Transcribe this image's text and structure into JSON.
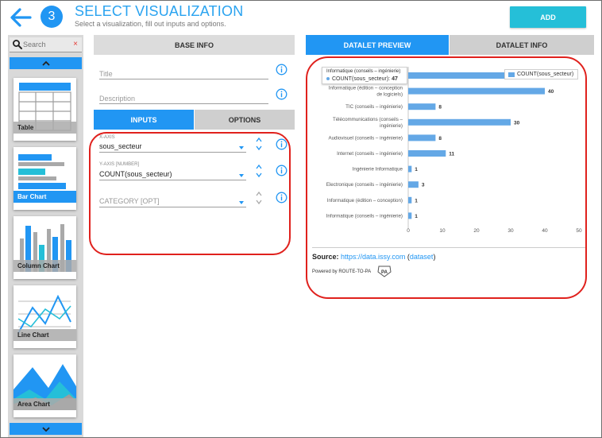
{
  "header": {
    "step_number": "3",
    "title": "SELECT VISUALIZATION",
    "subtitle": "Select a visualization, fill out inputs and options.",
    "add_label": "ADD"
  },
  "sidebar": {
    "search_placeholder": "Search",
    "clear_symbol": "×",
    "cards": [
      {
        "label": "Table",
        "icon": "table-icon",
        "selected": false
      },
      {
        "label": "Bar Chart",
        "icon": "bar-chart-icon",
        "selected": true
      },
      {
        "label": "Column Chart",
        "icon": "column-chart-icon",
        "selected": false
      },
      {
        "label": "Line Chart",
        "icon": "line-chart-icon",
        "selected": false
      },
      {
        "label": "Area Chart",
        "icon": "area-chart-icon",
        "selected": false
      }
    ]
  },
  "base_info": {
    "header": "BASE INFO",
    "title_placeholder": "Title",
    "description_placeholder": "Description",
    "tabs": {
      "inputs": "INPUTS",
      "options": "OPTIONS"
    },
    "inputs": [
      {
        "label": "X-AXIS",
        "value": "sous_secteur"
      },
      {
        "label": "Y-AXIS [NUMBER]",
        "value": "COUNT(sous_secteur)"
      },
      {
        "label": "",
        "value": "CATEGORY [OPT]"
      }
    ]
  },
  "preview": {
    "tabs": {
      "preview": "DATALET PREVIEW",
      "info": "DATALET INFO"
    },
    "tooltip": {
      "category": "Informatique (conseils – ingénierie)",
      "series": "COUNT(sous_secteur):",
      "value": "47"
    },
    "legend_label": "COUNT(sous_secteur)",
    "source_label": "Source:",
    "source_link": "https://data.issy.com",
    "dataset_link": "dataset",
    "powered_by": "Powered by ROUTE-TO-PA",
    "logo_text": "PA",
    "colors": {
      "bar": "#64a8e6",
      "accent": "#2196f3",
      "annotation": "#e0211d"
    }
  },
  "chart_data": {
    "type": "bar",
    "orientation": "horizontal",
    "categories": [
      [
        "Informatique (conseils – ingénierie)"
      ],
      [
        "Informatique (édition – conception",
        "de logiciels)"
      ],
      [
        "TIC (conseils – ingénierie)"
      ],
      [
        "Télécommunications (conseils –",
        "ingénierie)"
      ],
      [
        "Audiovisuel (conseils – ingénierie)"
      ],
      [
        "Internet (conseils – ingénierie)"
      ],
      [
        "Ingénierie Informatique"
      ],
      [
        "Electronique (conseils – ingénierie)"
      ],
      [
        "Informatique (édition – conception)"
      ],
      [
        "Informatique (conseils – ingénierie)"
      ]
    ],
    "values": [
      47,
      40,
      8,
      30,
      8,
      11,
      1,
      3,
      1,
      1
    ],
    "show_value_labels": [
      false,
      true,
      true,
      true,
      true,
      true,
      true,
      true,
      true,
      true
    ],
    "series": [
      {
        "name": "COUNT(sous_secteur)",
        "values": [
          47,
          40,
          8,
          30,
          8,
          11,
          1,
          3,
          1,
          1
        ]
      }
    ],
    "xlim": [
      0,
      50
    ],
    "xticks": [
      0,
      10,
      20,
      30,
      40,
      50
    ],
    "grid": false,
    "legend": "top-right"
  }
}
